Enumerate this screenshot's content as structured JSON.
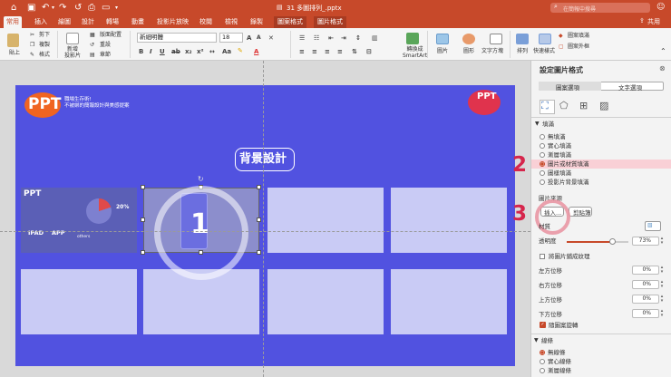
{
  "window": {
    "title": "31 多圖排列_.pptx",
    "search_placeholder": "在簡報中搜尋",
    "share_label": "共用"
  },
  "tabs": [
    {
      "label": "常用"
    },
    {
      "label": "插入"
    },
    {
      "label": "繪圖"
    },
    {
      "label": "設計"
    },
    {
      "label": "轉場"
    },
    {
      "label": "動畫"
    },
    {
      "label": "投影片放映"
    },
    {
      "label": "校閱"
    },
    {
      "label": "檢視"
    },
    {
      "label": "錄製"
    },
    {
      "label": "圖案格式"
    },
    {
      "label": "圖片格式"
    }
  ],
  "ribbon": {
    "paste": "貼上",
    "cut": "剪下",
    "copy": "複製",
    "format": "格式",
    "new_slide": "新增\n投影片",
    "layout": "版面配置",
    "reset": "重設",
    "section": "章節",
    "font_name": "新細明體",
    "font_size": "18",
    "convert_smartart": "轉換成\nSmartArt",
    "picture": "圖片",
    "shapes": "圖形",
    "textbox": "文字方塊",
    "arrange": "排列",
    "quick_styles": "快速樣式",
    "shape_fill": "圖案填滿",
    "shape_outline": "圖案外框"
  },
  "slide": {
    "logo": "PPT",
    "tagline_1": "職場生存術!",
    "tagline_2": "不被綁的簡報設計與美感提案",
    "title": "背景設計",
    "step_number": "1",
    "corner_logo": "PPT",
    "thumb": {
      "logo": "PPT",
      "percent": "20%",
      "device": "IPAD",
      "app": "APP",
      "others": "others"
    }
  },
  "callouts": {
    "two": "2",
    "three": "3"
  },
  "panel": {
    "title": "設定圖片格式",
    "tab_shape": "圖案選項",
    "tab_text": "文字選項",
    "fill_section": "填滿",
    "fill_options": [
      {
        "label": "無填滿",
        "selected": false
      },
      {
        "label": "實心填滿",
        "selected": false
      },
      {
        "label": "漸層填滿",
        "selected": false
      },
      {
        "label": "圖片或材質填滿",
        "selected": true
      },
      {
        "label": "圖樣填滿",
        "selected": false
      },
      {
        "label": "投影片背景填滿",
        "selected": false
      }
    ],
    "picture_source": "圖片來源",
    "insert_button": "插入...",
    "clipboard_button": "剪貼簿",
    "texture": "材質",
    "transparency_label": "透明度",
    "transparency_value": "73%",
    "transparency": 0.73,
    "tile": "將圖片鋪成紋理",
    "offset_left": "左方位移",
    "offset_left_value": "0%",
    "offset_right": "右方位移",
    "offset_right_value": "0%",
    "offset_top": "上方位移",
    "offset_top_value": "0%",
    "offset_bottom": "下方位移",
    "offset_bottom_value": "0%",
    "rotate_with_shape": "隨圖案旋轉",
    "line_section": "線條",
    "line_options": [
      {
        "label": "無線條",
        "selected": true
      },
      {
        "label": "實心線條",
        "selected": false
      },
      {
        "label": "漸層線條",
        "selected": false
      }
    ]
  },
  "colors": {
    "accent": "#c7492a",
    "slide_bg": "#5152e0",
    "placeholder": "#c9cbf5",
    "logo_orange": "#f06421",
    "callout": "#d6264c"
  }
}
